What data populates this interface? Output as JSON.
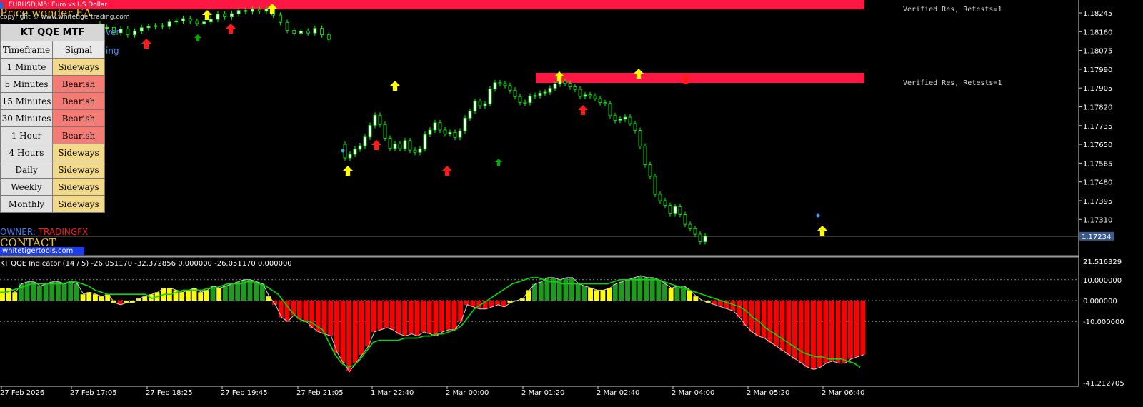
{
  "window": {
    "title": "EURUSD,M5:  Euro vs US Dollar"
  },
  "overlay": {
    "ea_title": "Price wonder EA",
    "copyright": "copyright © www.whitetigertrading.com",
    "hidden_fragments": [
      "ver",
      "ing"
    ],
    "owner_label": "OWNER: ",
    "owner_name": "TRADINGFX",
    "contact_label": "CONTACT",
    "contact_link": "whitetigertools.com"
  },
  "mtf_panel": {
    "title": "KT QQE MTF",
    "col_timeframe": "Timeframe",
    "col_signal": "Signal",
    "rows": [
      {
        "tf": "1 Minute",
        "signal": "Sideways"
      },
      {
        "tf": "5 Minutes",
        "signal": "Bearish"
      },
      {
        "tf": "15 Minutes",
        "signal": "Bearish"
      },
      {
        "tf": "30 Minutes",
        "signal": "Bearish"
      },
      {
        "tf": "1 Hour",
        "signal": "Bearish"
      },
      {
        "tf": "4 Hours",
        "signal": "Sideways"
      },
      {
        "tf": "Daily",
        "signal": "Sideways"
      },
      {
        "tf": "Weekly",
        "signal": "Sideways"
      },
      {
        "tf": "Monthly",
        "signal": "Sideways"
      }
    ]
  },
  "zones": [
    {
      "label": "Verified Res, Retests=1"
    },
    {
      "label": "Verified Res, Retests=1"
    }
  ],
  "price_axis": {
    "labels": [
      "1.18245",
      "1.18160",
      "1.18075",
      "1.17990",
      "1.17905",
      "1.17820",
      "1.17735",
      "1.17650",
      "1.17565",
      "1.17480",
      "1.17395",
      "1.17310"
    ],
    "current_price": "1.17234"
  },
  "indicator": {
    "title": "KT QQE Indicator (14 / 5) -26.051170 -32.372856 0.000000 -26.051170 0.000000",
    "axis_labels": [
      "21.516329",
      "10.000000",
      "0.000000",
      "-10.000000",
      "-41.212705"
    ]
  },
  "time_axis": {
    "labels": [
      "27 Feb 2026",
      "27 Feb 17:05",
      "27 Feb 18:25",
      "27 Feb 19:45",
      "27 Feb 21:05",
      "1 Mar 22:40",
      "2 Mar 00:00",
      "2 Mar 01:20",
      "2 Mar 02:40",
      "2 Mar 04:00",
      "2 Mar 05:20",
      "2 Mar 06:40"
    ]
  },
  "colors": {
    "background": "#000000",
    "bull_candle": "#ffffff",
    "candle_wick": "#00ff00",
    "zone": "#ff1744",
    "arrow_up_yellow": "#ffff00",
    "arrow_up_red": "#ff1a1a",
    "arrow_up_green": "#00aa00",
    "hist_green": "#1e9b1e",
    "hist_yellow": "#ffff00",
    "hist_red": "#ff0000",
    "qqe_line": "#00dd00"
  },
  "chart_data": {
    "type": "candlestick",
    "candles": [
      {
        "o": 1.18196,
        "c": 1.18176
      },
      {
        "o": 1.18176,
        "c": 1.18179
      },
      {
        "o": 1.18179,
        "c": 1.18155
      },
      {
        "o": 1.18155,
        "c": 1.18172
      },
      {
        "o": 1.18172,
        "c": 1.18146
      },
      {
        "o": 1.18146,
        "c": 1.18162
      },
      {
        "o": 1.18162,
        "c": 1.18178
      },
      {
        "o": 1.18178,
        "c": 1.18183
      },
      {
        "o": 1.18183,
        "c": 1.18187
      },
      {
        "o": 1.18187,
        "c": 1.18183
      },
      {
        "o": 1.18183,
        "c": 1.18204
      },
      {
        "o": 1.18204,
        "c": 1.18209
      },
      {
        "o": 1.18209,
        "c": 1.18219
      },
      {
        "o": 1.18219,
        "c": 1.18207
      },
      {
        "o": 1.18207,
        "c": 1.18197
      },
      {
        "o": 1.18197,
        "c": 1.18204
      },
      {
        "o": 1.18204,
        "c": 1.18216
      },
      {
        "o": 1.18216,
        "c": 1.18239
      },
      {
        "o": 1.18239,
        "c": 1.18227
      },
      {
        "o": 1.18227,
        "c": 1.18241
      },
      {
        "o": 1.18241,
        "c": 1.18256
      },
      {
        "o": 1.18256,
        "c": 1.18251
      },
      {
        "o": 1.18251,
        "c": 1.18261
      },
      {
        "o": 1.18261,
        "c": 1.18252
      },
      {
        "o": 1.18252,
        "c": 1.18262
      },
      {
        "o": 1.18262,
        "c": 1.18235
      },
      {
        "o": 1.18235,
        "c": 1.18202
      },
      {
        "o": 1.18202,
        "c": 1.18166
      },
      {
        "o": 1.18166,
        "c": 1.18153
      },
      {
        "o": 1.18153,
        "c": 1.18163
      },
      {
        "o": 1.18163,
        "c": 1.18154
      },
      {
        "o": 1.18154,
        "c": 1.18175
      },
      {
        "o": 1.18175,
        "c": 1.18146
      },
      {
        "o": 1.18146,
        "c": 1.18125
      },
      {
        "o": 1.1765,
        "c": 1.17589
      },
      {
        "o": 1.17589,
        "c": 1.17605
      },
      {
        "o": 1.17605,
        "c": 1.17628
      },
      {
        "o": 1.17628,
        "c": 1.17644
      },
      {
        "o": 1.17644,
        "c": 1.17683
      },
      {
        "o": 1.17683,
        "c": 1.17736
      },
      {
        "o": 1.17736,
        "c": 1.17782
      },
      {
        "o": 1.17782,
        "c": 1.1774
      },
      {
        "o": 1.1774,
        "c": 1.17678
      },
      {
        "o": 1.17678,
        "c": 1.17632
      },
      {
        "o": 1.17632,
        "c": 1.17652
      },
      {
        "o": 1.17652,
        "c": 1.17631
      },
      {
        "o": 1.17631,
        "c": 1.17667
      },
      {
        "o": 1.17667,
        "c": 1.17624
      },
      {
        "o": 1.17624,
        "c": 1.17614
      },
      {
        "o": 1.17614,
        "c": 1.1763
      },
      {
        "o": 1.1763,
        "c": 1.17695
      },
      {
        "o": 1.17695,
        "c": 1.17715
      },
      {
        "o": 1.17715,
        "c": 1.17748
      },
      {
        "o": 1.17748,
        "c": 1.17715
      },
      {
        "o": 1.17715,
        "c": 1.17697
      },
      {
        "o": 1.17697,
        "c": 1.17704
      },
      {
        "o": 1.17704,
        "c": 1.17682
      },
      {
        "o": 1.17682,
        "c": 1.17711
      },
      {
        "o": 1.17711,
        "c": 1.17769
      },
      {
        "o": 1.17769,
        "c": 1.178
      },
      {
        "o": 1.178,
        "c": 1.17845
      },
      {
        "o": 1.17845,
        "c": 1.17825
      },
      {
        "o": 1.17825,
        "c": 1.17834
      },
      {
        "o": 1.17834,
        "c": 1.17901
      },
      {
        "o": 1.17901,
        "c": 1.17929
      },
      {
        "o": 1.17929,
        "c": 1.17925
      },
      {
        "o": 1.17925,
        "c": 1.17916
      },
      {
        "o": 1.17916,
        "c": 1.17895
      },
      {
        "o": 1.17895,
        "c": 1.17866
      },
      {
        "o": 1.17866,
        "c": 1.1784
      },
      {
        "o": 1.1784,
        "c": 1.17839
      },
      {
        "o": 1.17839,
        "c": 1.17868
      },
      {
        "o": 1.17868,
        "c": 1.17871
      },
      {
        "o": 1.17871,
        "c": 1.17882
      },
      {
        "o": 1.17882,
        "c": 1.17886
      },
      {
        "o": 1.17886,
        "c": 1.17904
      },
      {
        "o": 1.17904,
        "c": 1.17923
      },
      {
        "o": 1.17923,
        "c": 1.17935
      },
      {
        "o": 1.17935,
        "c": 1.17926
      },
      {
        "o": 1.17926,
        "c": 1.1791
      },
      {
        "o": 1.1791,
        "c": 1.17899
      },
      {
        "o": 1.17899,
        "c": 1.17867
      },
      {
        "o": 1.17867,
        "c": 1.17874
      },
      {
        "o": 1.17874,
        "c": 1.17869
      },
      {
        "o": 1.17869,
        "c": 1.17857
      },
      {
        "o": 1.17857,
        "c": 1.17839
      },
      {
        "o": 1.17839,
        "c": 1.17835
      },
      {
        "o": 1.17835,
        "c": 1.1778
      },
      {
        "o": 1.1778,
        "c": 1.17759
      },
      {
        "o": 1.17759,
        "c": 1.17764
      },
      {
        "o": 1.17764,
        "c": 1.17773
      },
      {
        "o": 1.17773,
        "c": 1.17744
      },
      {
        "o": 1.17744,
        "c": 1.17713
      },
      {
        "o": 1.17713,
        "c": 1.17642
      },
      {
        "o": 1.17642,
        "c": 1.17558
      },
      {
        "o": 1.17558,
        "c": 1.17505
      },
      {
        "o": 1.17505,
        "c": 1.17424
      },
      {
        "o": 1.17424,
        "c": 1.17395
      },
      {
        "o": 1.17395,
        "c": 1.17374
      },
      {
        "o": 1.17374,
        "c": 1.17335
      },
      {
        "o": 1.17335,
        "c": 1.17368
      },
      {
        "o": 1.17368,
        "c": 1.17332
      },
      {
        "o": 1.17332,
        "c": 1.17288
      },
      {
        "o": 1.17288,
        "c": 1.17268
      },
      {
        "o": 1.17268,
        "c": 1.17243
      },
      {
        "o": 1.17243,
        "c": 1.17209
      },
      {
        "o": 1.17209,
        "c": 1.17234
      }
    ],
    "histogram": [
      6,
      6,
      4,
      8,
      9,
      9,
      7,
      8,
      9,
      9,
      8,
      9,
      8,
      3,
      4,
      3,
      2,
      3,
      -1,
      -2,
      -1,
      -1,
      1,
      2,
      3,
      4,
      6,
      6,
      5,
      4,
      5,
      6,
      4,
      5,
      7,
      6,
      7,
      8,
      9,
      10,
      10,
      9,
      8,
      2,
      -2,
      -8,
      -10,
      -7,
      -9,
      -10,
      -13,
      -15,
      -16,
      -17,
      -25,
      -30,
      -34,
      -30,
      -26,
      -22,
      -15,
      -14,
      -13,
      -14,
      -16,
      -17,
      -16,
      -17,
      -15,
      -16,
      -17,
      -15,
      -14,
      -14,
      -10,
      -2,
      -3,
      -4,
      -4,
      -3,
      -2,
      -3,
      -1,
      0,
      1,
      5,
      8,
      9,
      11,
      11,
      10,
      11,
      11,
      8,
      7,
      6,
      5,
      5,
      6,
      8,
      9,
      10,
      11,
      12,
      11,
      11,
      10,
      8,
      6,
      7,
      7,
      5,
      2,
      0,
      -1,
      -2,
      -3,
      -4,
      -5,
      -8,
      -12,
      -15,
      -17,
      -18,
      -20,
      -22,
      -24,
      -26,
      -28,
      -30,
      -32,
      -33,
      -32,
      -30,
      -29,
      -30,
      -30,
      -28,
      -27,
      -26
    ],
    "qqe_line": [
      4,
      4,
      5,
      6,
      7,
      8,
      8,
      8,
      8,
      8,
      8,
      9,
      9,
      8,
      7,
      5,
      4,
      3,
      3,
      3,
      3,
      3,
      3,
      3,
      1,
      2,
      3,
      3,
      4,
      5,
      5,
      5,
      5,
      6,
      6,
      7,
      8,
      8,
      8,
      9,
      9,
      8,
      7,
      5,
      3,
      -1,
      -5,
      -8,
      -10,
      -10,
      -12,
      -14,
      -20,
      -26,
      -30,
      -32,
      -31,
      -28,
      -24,
      -20,
      -19,
      -19,
      -19,
      -19,
      -18,
      -18,
      -18,
      -17,
      -17,
      -16,
      -16,
      -15,
      -14,
      -12,
      -8,
      -4,
      -2,
      0,
      2,
      4,
      6,
      8,
      9,
      10,
      11,
      11,
      10,
      9,
      9,
      8,
      8,
      8,
      8,
      8,
      8,
      8,
      8,
      9,
      10,
      10,
      10,
      10,
      10,
      10,
      10,
      9,
      8,
      7,
      6,
      5,
      4,
      3,
      2,
      1,
      0,
      -1,
      -2,
      -3,
      -5,
      -8,
      -10,
      -13,
      -15,
      -17,
      -19,
      -21,
      -23,
      -25,
      -26,
      -27,
      -27,
      -28,
      -28,
      -28,
      -29,
      -30,
      -32
    ],
    "price_ylim": [
      1.17234,
      1.18245
    ],
    "indicator_ylim": [
      -41.212705,
      21.516329
    ]
  }
}
